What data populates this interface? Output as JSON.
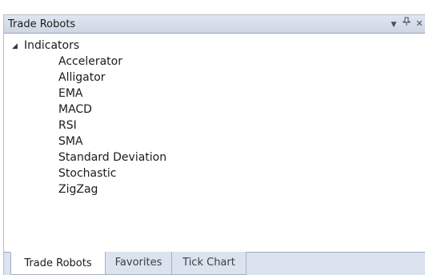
{
  "window": {
    "title": "Trade Robots",
    "controls": {
      "dropdown_glyph": "▼",
      "pin_glyph": "ᐩ",
      "close_glyph": "✕"
    }
  },
  "tree": {
    "root": {
      "expander_glyph": "◢",
      "label": "Indicators",
      "expanded": true
    },
    "items": [
      "Accelerator",
      "Alligator",
      "EMA",
      "MACD",
      "RSI",
      "SMA",
      "Standard Deviation",
      "Stochastic",
      "ZigZag"
    ]
  },
  "tabs": [
    {
      "label": "Trade Robots",
      "active": true
    },
    {
      "label": "Favorites",
      "active": false
    },
    {
      "label": "Tick Chart",
      "active": false
    }
  ]
}
